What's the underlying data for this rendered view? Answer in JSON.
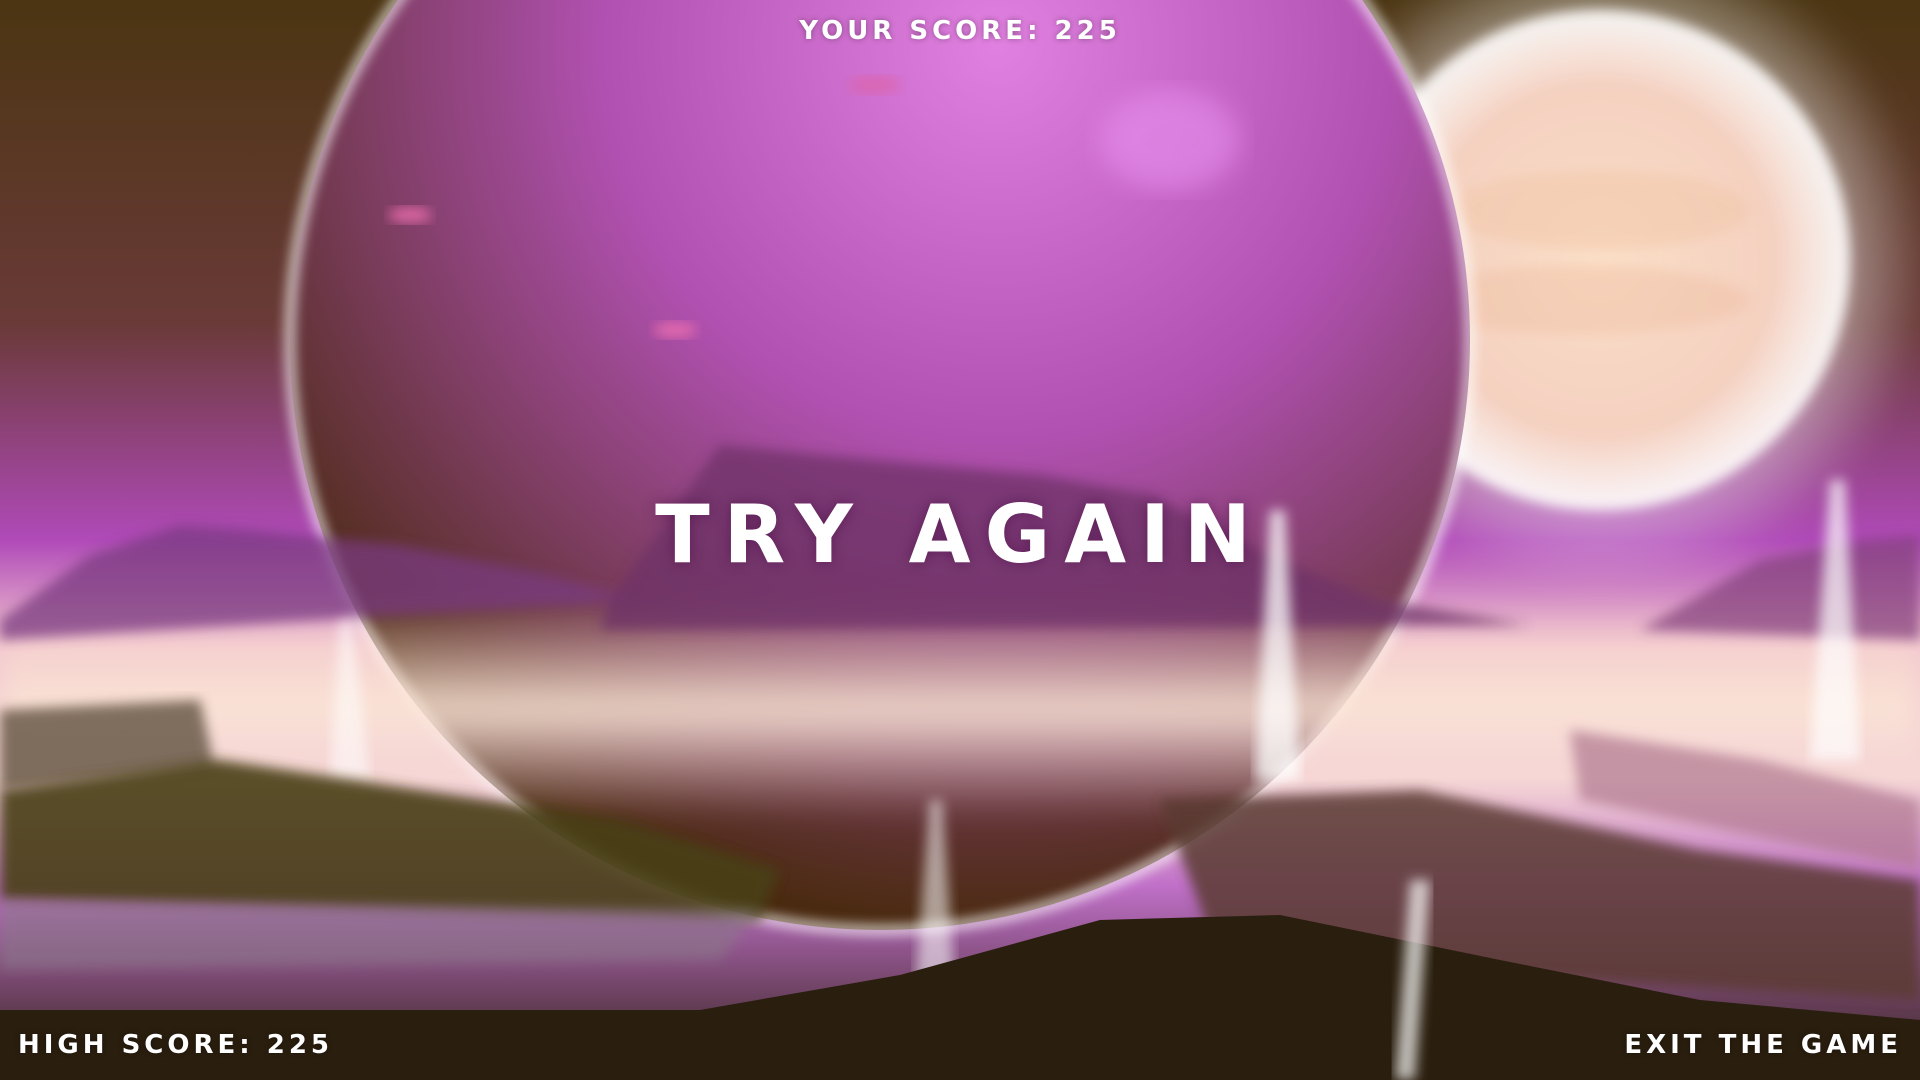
{
  "hud": {
    "your_score_label": "YOUR SCORE:",
    "your_score_value": "225",
    "high_score_label": "HIGH SCORE:",
    "high_score_value": "225"
  },
  "menu": {
    "try_again_label": "TRY AGAIN",
    "exit_label": "EXIT THE GAME"
  },
  "colors": {
    "sky_top": "#4a3210",
    "planet": "#b050b0",
    "haze": "#f0c8d8",
    "ground": "#2a1e10",
    "text": "#ffffff"
  }
}
